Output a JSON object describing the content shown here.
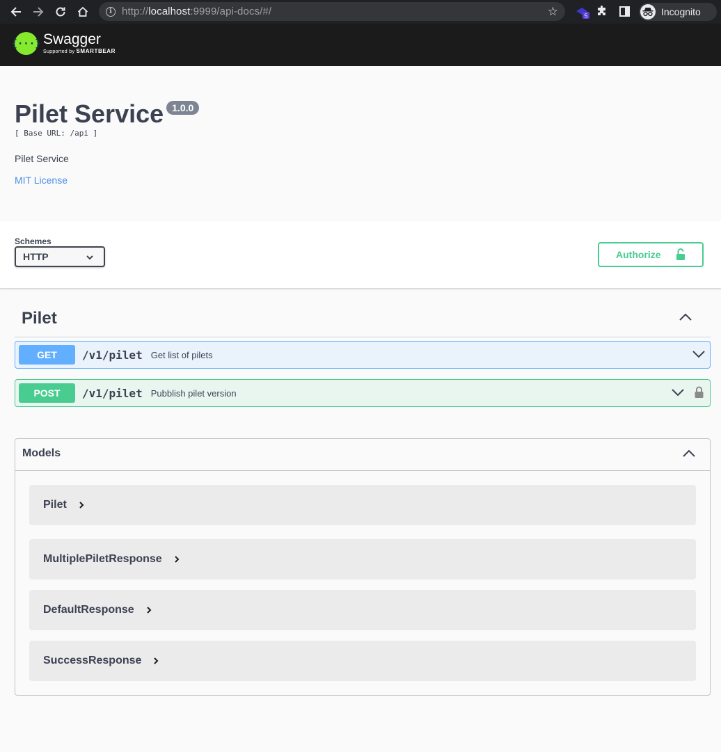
{
  "browser": {
    "url_host": "localhost",
    "url_prefix": "http://",
    "url_suffix": ":9999/api-docs/#/",
    "extension_badge": "5",
    "profile_label": "Incognito"
  },
  "topbar": {
    "logo_symbol": "{···}",
    "logo_name": "Swagger",
    "logo_supported": "Supported by",
    "logo_company": "SMARTBEAR"
  },
  "info": {
    "title": "Pilet Service",
    "version": "1.0.0",
    "base_url": "[ Base URL: /api ]",
    "description": "Pilet Service",
    "license": "MIT License"
  },
  "schemes": {
    "label": "Schemes",
    "selected": "HTTP",
    "authorize_label": "Authorize"
  },
  "tag": {
    "name": "Pilet",
    "operations": [
      {
        "method": "GET",
        "path": "/v1/pilet",
        "summary": "Get list of pilets"
      },
      {
        "method": "POST",
        "path": "/v1/pilet",
        "summary": "Pubblish pilet version"
      }
    ]
  },
  "models": {
    "title": "Models",
    "items": [
      "Pilet",
      "MultiplePiletResponse",
      "DefaultResponse",
      "SuccessResponse"
    ]
  },
  "colors": {
    "get": "#61affe",
    "post": "#49cc90",
    "text": "#3b4151",
    "link": "#4990e2",
    "logo": "#85ea2d"
  }
}
